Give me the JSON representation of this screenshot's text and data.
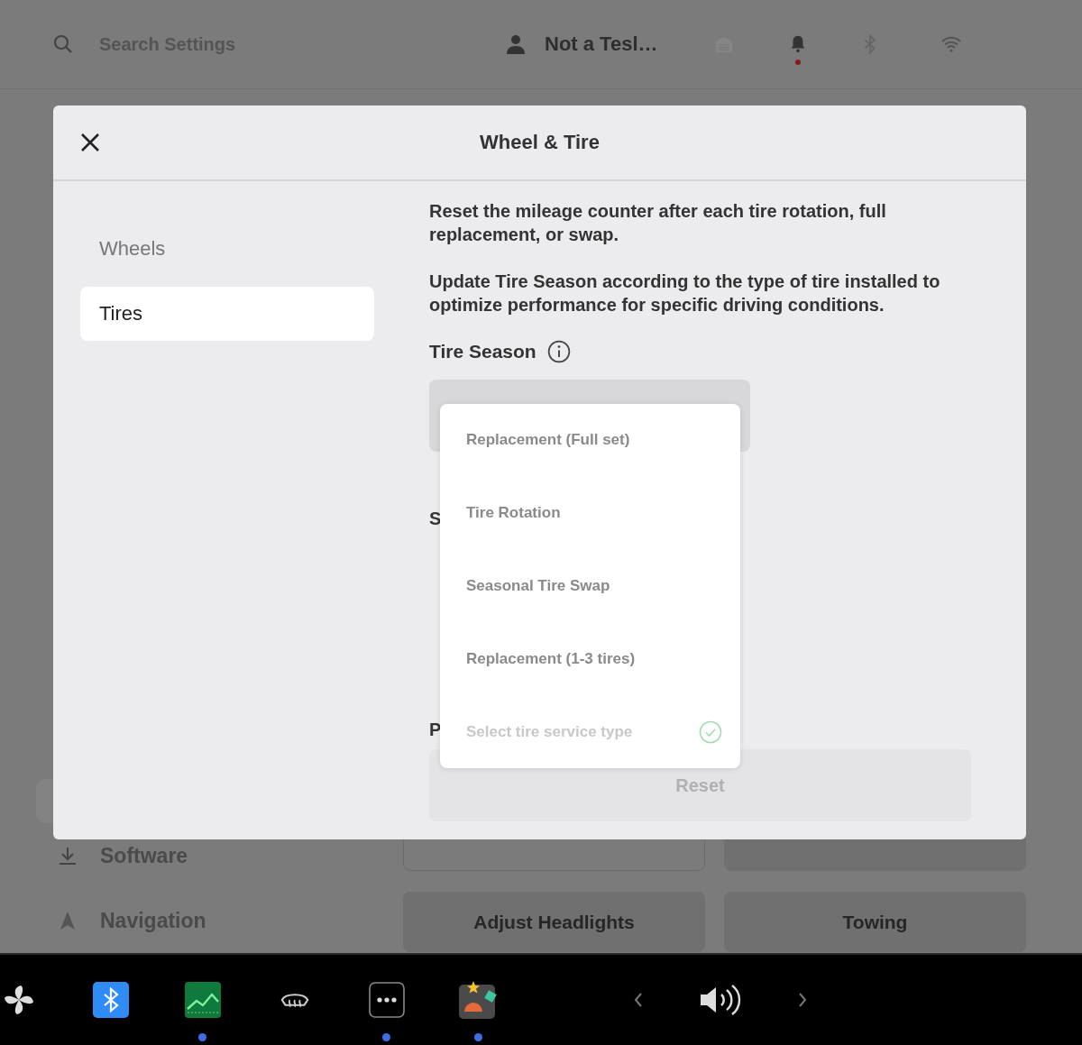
{
  "top_bar": {
    "search": {
      "placeholder": "Search Settings"
    },
    "profile_name": "Not a Tesl…",
    "notification_unread": true
  },
  "background": {
    "sidebar_items": [
      {
        "label": "Software",
        "kind": "download"
      },
      {
        "label": "Navigation",
        "kind": "navigation"
      }
    ],
    "buttons": [
      "Adjust Headlights",
      "Towing"
    ]
  },
  "dialog": {
    "title": "Wheel & Tire",
    "tabs": [
      {
        "label": "Wheels",
        "selected": false
      },
      {
        "label": "Tires",
        "selected": true
      }
    ],
    "paragraphs": [
      "Reset the mileage counter after each tire rotation, full replacement, or swap.",
      "Update Tire Season according to the type of tire installed to optimize performance for specific driving conditions."
    ],
    "tire_season_label": "Tire Season",
    "section_2_label": "S",
    "section_3_label": "P",
    "dropdown_options": [
      {
        "label": "Replacement (Full set)",
        "selected": false
      },
      {
        "label": "Tire Rotation",
        "selected": false
      },
      {
        "label": "Seasonal Tire Swap",
        "selected": false
      },
      {
        "label": "Replacement (1-3 tires)",
        "selected": false
      },
      {
        "label": "Select tire service type",
        "selected": true
      }
    ],
    "reset_button": {
      "label": "Reset",
      "disabled": true
    }
  },
  "taskbar": {
    "apps": [
      {
        "kind": "fan",
        "running": false
      },
      {
        "kind": "bluetooth",
        "running": false
      },
      {
        "kind": "chart",
        "running": true
      },
      {
        "kind": "defrost",
        "running": false
      },
      {
        "kind": "more",
        "running": true
      },
      {
        "kind": "toybox",
        "running": true
      }
    ]
  }
}
